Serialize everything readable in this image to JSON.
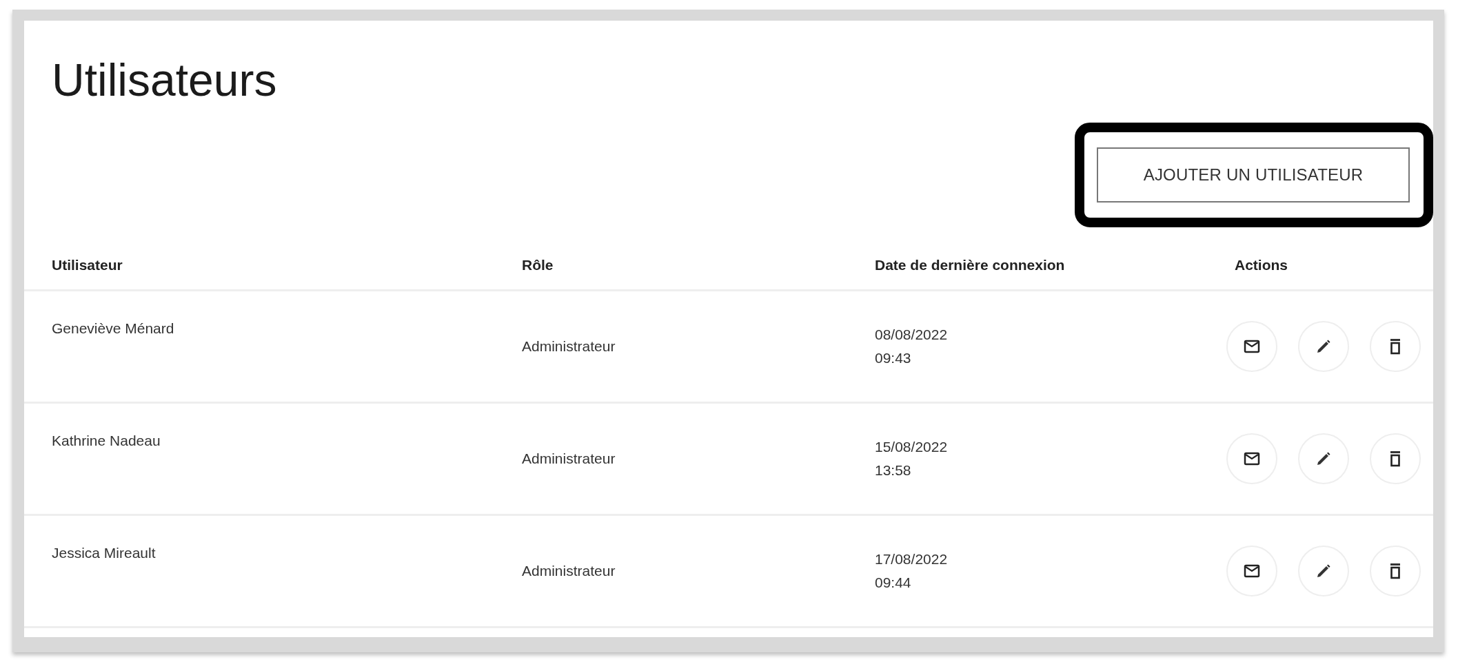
{
  "title": "Utilisateurs",
  "add_button": {
    "label": "AJOUTER UN UTILISATEUR",
    "highlighted": true
  },
  "table": {
    "columns": [
      "Utilisateur",
      "Rôle",
      "Date de dernière connexion",
      "Actions"
    ],
    "rows": [
      {
        "user": "Geneviève Ménard",
        "role": "Administrateur",
        "date": "08/08/2022",
        "time": "09:43"
      },
      {
        "user": "Kathrine Nadeau",
        "role": "Administrateur",
        "date": "15/08/2022",
        "time": "13:58"
      },
      {
        "user": "Jessica Mireault",
        "role": "Administrateur",
        "date": "17/08/2022",
        "time": "09:44"
      }
    ]
  }
}
